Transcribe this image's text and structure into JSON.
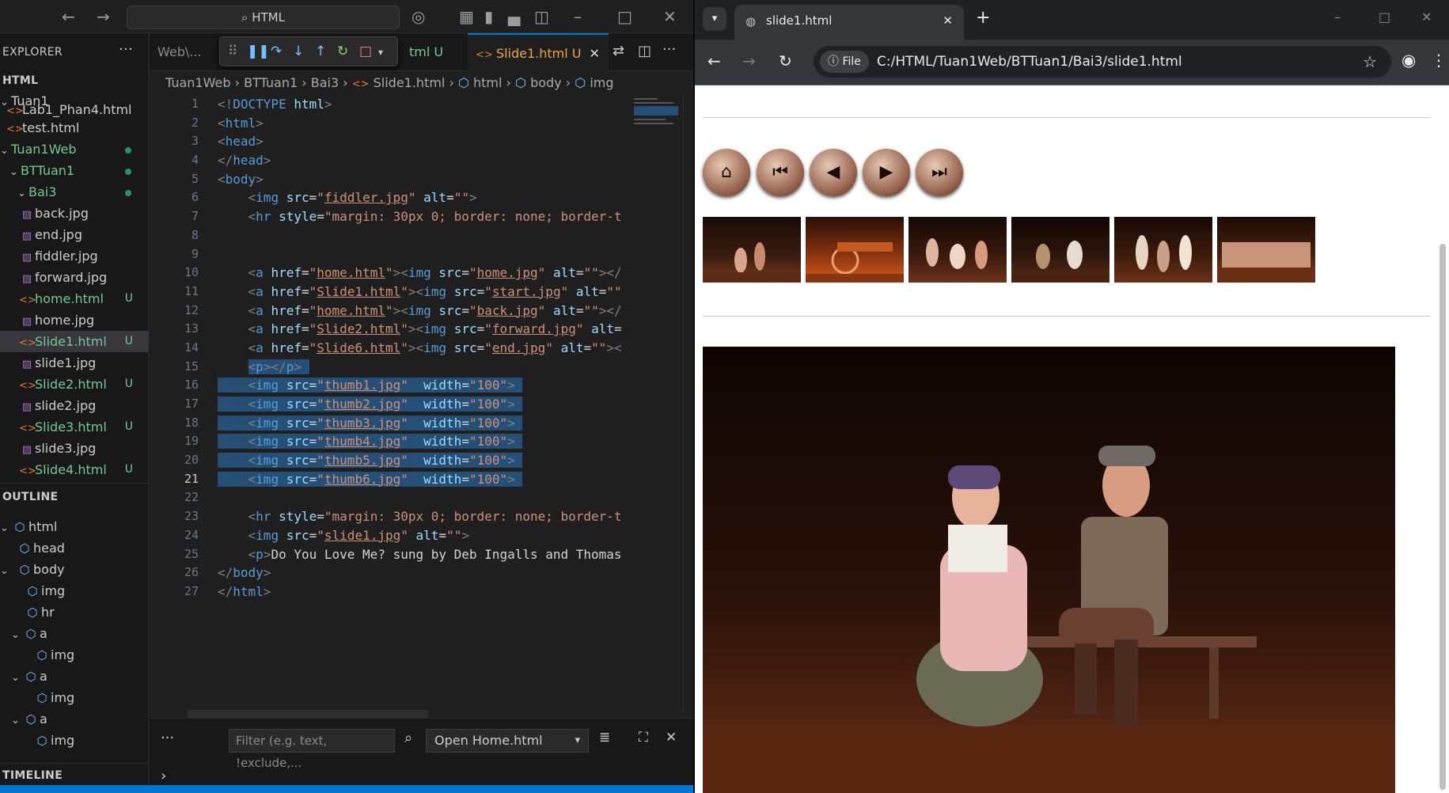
{
  "vscode": {
    "search_box": "HTML",
    "explorer_label": "EXPLORER",
    "workspace": "HTML",
    "files": [
      {
        "name": "Tuan1",
        "kind": "folder"
      },
      {
        "name": "Lab1_Phan4.html",
        "kind": "html"
      },
      {
        "name": "test.html",
        "kind": "html"
      },
      {
        "name": "Tuan1Web",
        "kind": "folder"
      },
      {
        "name": "BTTuan1",
        "kind": "folder"
      },
      {
        "name": "Bai3",
        "kind": "folder"
      },
      {
        "name": "back.jpg",
        "kind": "img"
      },
      {
        "name": "end.jpg",
        "kind": "img"
      },
      {
        "name": "fiddler.jpg",
        "kind": "img"
      },
      {
        "name": "forward.jpg",
        "kind": "img"
      },
      {
        "name": "home.html",
        "kind": "html",
        "status": "U"
      },
      {
        "name": "home.jpg",
        "kind": "img"
      },
      {
        "name": "Slide1.html",
        "kind": "html",
        "status": "U"
      },
      {
        "name": "slide1.jpg",
        "kind": "img"
      },
      {
        "name": "Slide2.html",
        "kind": "html",
        "status": "U"
      },
      {
        "name": "slide2.jpg",
        "kind": "img"
      },
      {
        "name": "Slide3.html",
        "kind": "html",
        "status": "U"
      },
      {
        "name": "slide3.jpg",
        "kind": "img"
      },
      {
        "name": "Slide4.html",
        "kind": "html",
        "status": "U"
      }
    ],
    "outline_label": "OUTLINE",
    "outline": [
      "html",
      "head",
      "body",
      "img",
      "hr",
      "a",
      "img",
      "a",
      "img",
      "a",
      "img"
    ],
    "timeline_label": "TIMELINE",
    "tabs": [
      "Web\\...",
      "tml U",
      "Slide1.html U"
    ],
    "breadcrumb": [
      "Tuan1Web",
      "BTTuan1",
      "Bai3",
      "Slide1.html",
      "html",
      "body",
      "img"
    ],
    "line_numbers": [
      "1",
      "2",
      "3",
      "4",
      "5",
      "6",
      "7",
      "8",
      "9",
      "10",
      "11",
      "12",
      "13",
      "14",
      "15",
      "16",
      "17",
      "18",
      "19",
      "20",
      "21",
      "22",
      "23",
      "24",
      "25",
      "26",
      "27"
    ],
    "filter_placeholder": "Filter (e.g. text, !exclude,...",
    "launch_target": "Open Home.html"
  },
  "chrome": {
    "tab_title": "slide1.html",
    "scheme_label": "File",
    "url": "C:/HTML/Tuan1Web/BTTuan1/Bai3/slide1.html",
    "nav_buttons": [
      "home",
      "start",
      "back",
      "forward",
      "end"
    ]
  },
  "colors": {
    "accent": "#0078d4",
    "html_icon": "#e37933",
    "untracked": "#73c991"
  }
}
